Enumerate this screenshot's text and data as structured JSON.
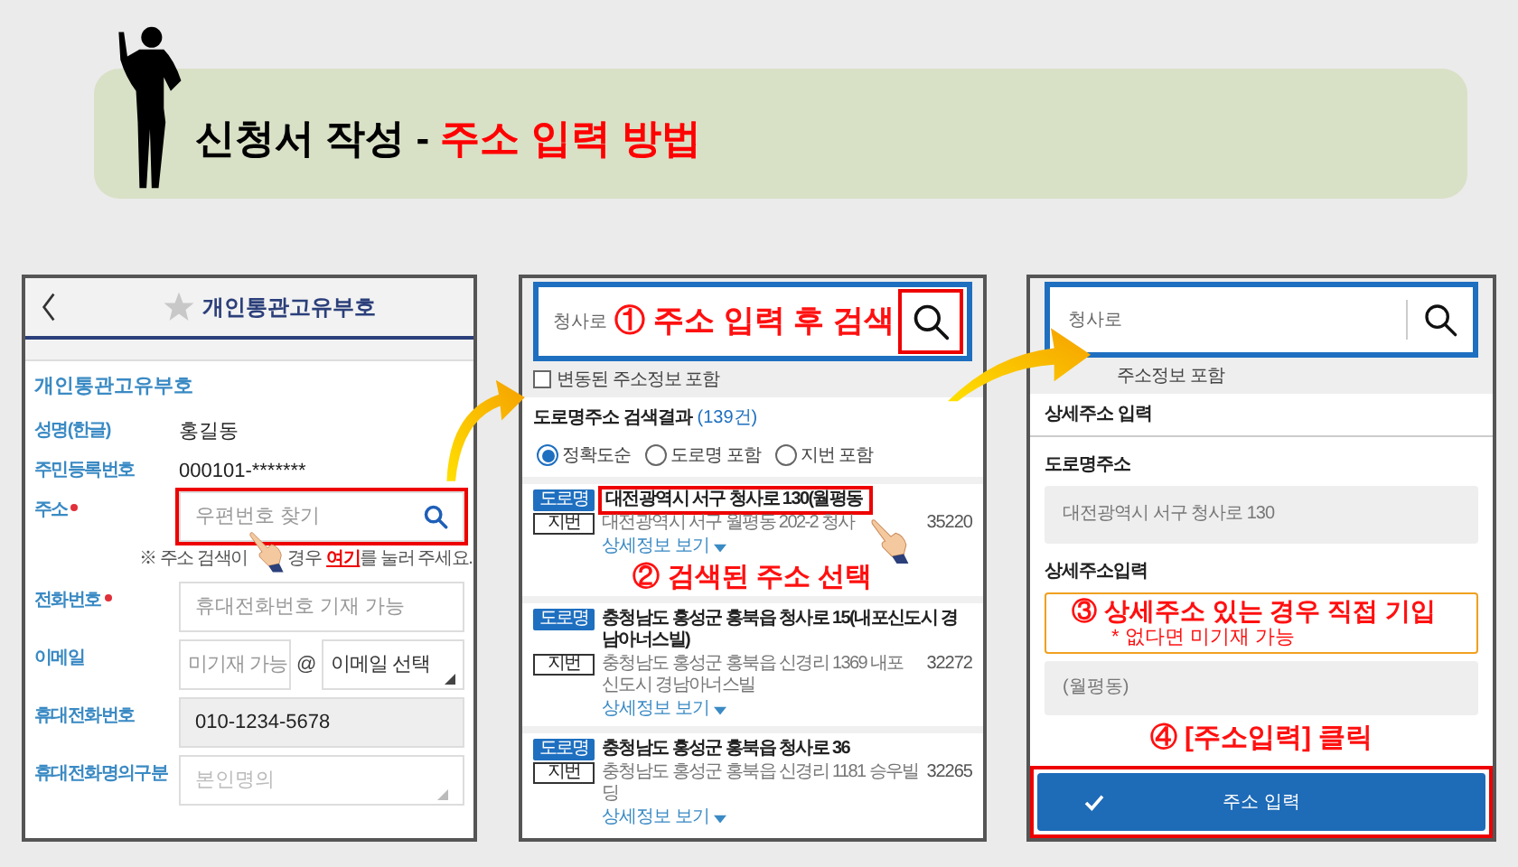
{
  "banner": {
    "title": "신청서 작성 - ",
    "title_highlight": "주소 입력 방법"
  },
  "form_screen": {
    "title": "개인통관고유부호",
    "section": "개인통관고유부호",
    "fields": [
      {
        "kind": "text",
        "label": "성명(한글)",
        "required": false,
        "highlighted": false,
        "value": "홍길동"
      },
      {
        "kind": "text",
        "label": "주민등록번호",
        "required": false,
        "highlighted": false,
        "value": "000101-*******"
      },
      {
        "kind": "search",
        "label": "주소",
        "required": true,
        "highlighted": true,
        "placeholder": "우편번호 찾기",
        "note_before": "※  주소 검색이",
        "note_after": "경우",
        "note_link": "여기",
        "note_end": "를 눌러 주세요."
      },
      {
        "kind": "input",
        "label": "전화번호",
        "required": true,
        "highlighted": false,
        "placeholder": "휴대전화번호 기재 가능"
      },
      {
        "kind": "email",
        "label": "이메일",
        "required": false,
        "highlighted": false,
        "placeholder": "미기재 가능",
        "at": "@",
        "select": "이메일 선택"
      },
      {
        "kind": "readonly",
        "label": "휴대전화번호",
        "required": false,
        "highlighted": false,
        "value": "010-1234-5678"
      },
      {
        "kind": "select",
        "label": "휴대전화명의구분",
        "required": false,
        "highlighted": false,
        "placeholder": "본인명의"
      }
    ]
  },
  "search_screen": {
    "query": "청사로",
    "callout_1": "① 주소 입력 후 검색",
    "checkbox": {
      "label": "변동된 주소정보 포함",
      "checked": false
    },
    "results_title": "도로명주소 검색결과",
    "results_count": "(139건)",
    "sort_options": [
      {
        "label": "정확도순",
        "selected": true
      },
      {
        "label": "도로명 포함",
        "selected": false
      },
      {
        "label": "지번 포함",
        "selected": false
      }
    ],
    "results": [
      {
        "road_tag": "도로명",
        "road": "대전광역시 서구 청사로 130(월평동",
        "jibun_tag": "지번",
        "jibun": "대전광역시 서구 월평동 202-2 청사",
        "postcode": "35220",
        "more": "상세정보 보기",
        "highlighted": true
      },
      {
        "road_tag": "도로명",
        "road": "충청남도 홍성군 홍북읍 청사로 15(내포신도시 경남아너스빌)",
        "jibun_tag": "지번",
        "jibun": "충청남도 홍성군 홍북읍 신경리 1369 내포신도시 경남아너스빌",
        "postcode": "32272",
        "more": "상세정보 보기",
        "highlighted": false
      },
      {
        "road_tag": "도로명",
        "road": "충청남도 홍성군 홍북읍 청사로 36",
        "jibun_tag": "지번",
        "jibun": "충청남도 홍성군 홍북읍 신경리 1181 승우빌딩",
        "postcode": "32265",
        "more": "상세정보 보기",
        "highlighted": false
      }
    ],
    "callout_2": "② 검색된 주소 선택"
  },
  "detail_screen": {
    "query": "청사로",
    "checkbox_label": "주소정보 포함",
    "section": "상세주소 입력",
    "road_label": "도로명주소",
    "road_value": "대전광역시 서구 청사로 130",
    "detail_label": "상세주소입력",
    "callout_3": "③ 상세주소 있는 경우 직접 기입",
    "callout_3_note": "* 없다면 미기재 가능",
    "detail_value": "(월평동)",
    "callout_4": "④ [주소입력] 클릭",
    "submit": "주소 입력"
  }
}
